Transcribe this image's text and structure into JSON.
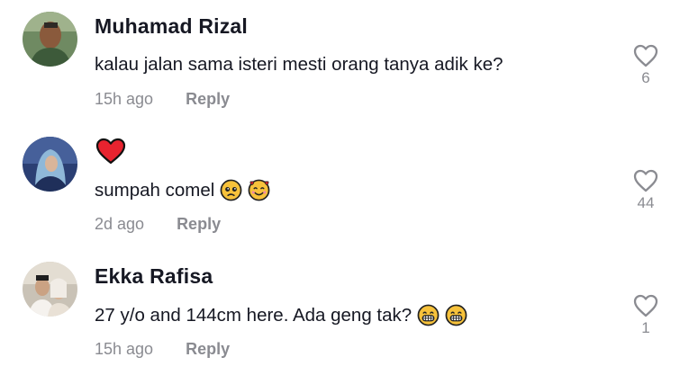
{
  "comments": [
    {
      "username": "Muhamad Rizal",
      "text": "kalau jalan sama isteri mesti orang tanya adik ke?",
      "time": "15h ago",
      "reply_label": "Reply",
      "likes": "6",
      "avatar_icon": "avatar-photo-man-outdoor"
    },
    {
      "username": "",
      "header_icon": "red-heart-emoji",
      "text": "sumpah comel",
      "emojis": [
        "pleading-face-emoji",
        "smiling-face-with-hearts-emoji"
      ],
      "time": "2d ago",
      "reply_label": "Reply",
      "likes": "44",
      "avatar_icon": "avatar-photo-woman-hijab"
    },
    {
      "username": "Ekka Rafisa",
      "text": "27 y/o and 144cm here. Ada geng tak?",
      "emojis": [
        "grinning-face-emoji",
        "grinning-face-emoji"
      ],
      "time": "15h ago",
      "reply_label": "Reply",
      "likes": "1",
      "avatar_icon": "avatar-photo-couple"
    }
  ],
  "colors": {
    "primary_text": "#161823",
    "secondary_text": "#8a8b91",
    "heart_outline": "#8a8b91",
    "red_heart": "#e8232f"
  }
}
